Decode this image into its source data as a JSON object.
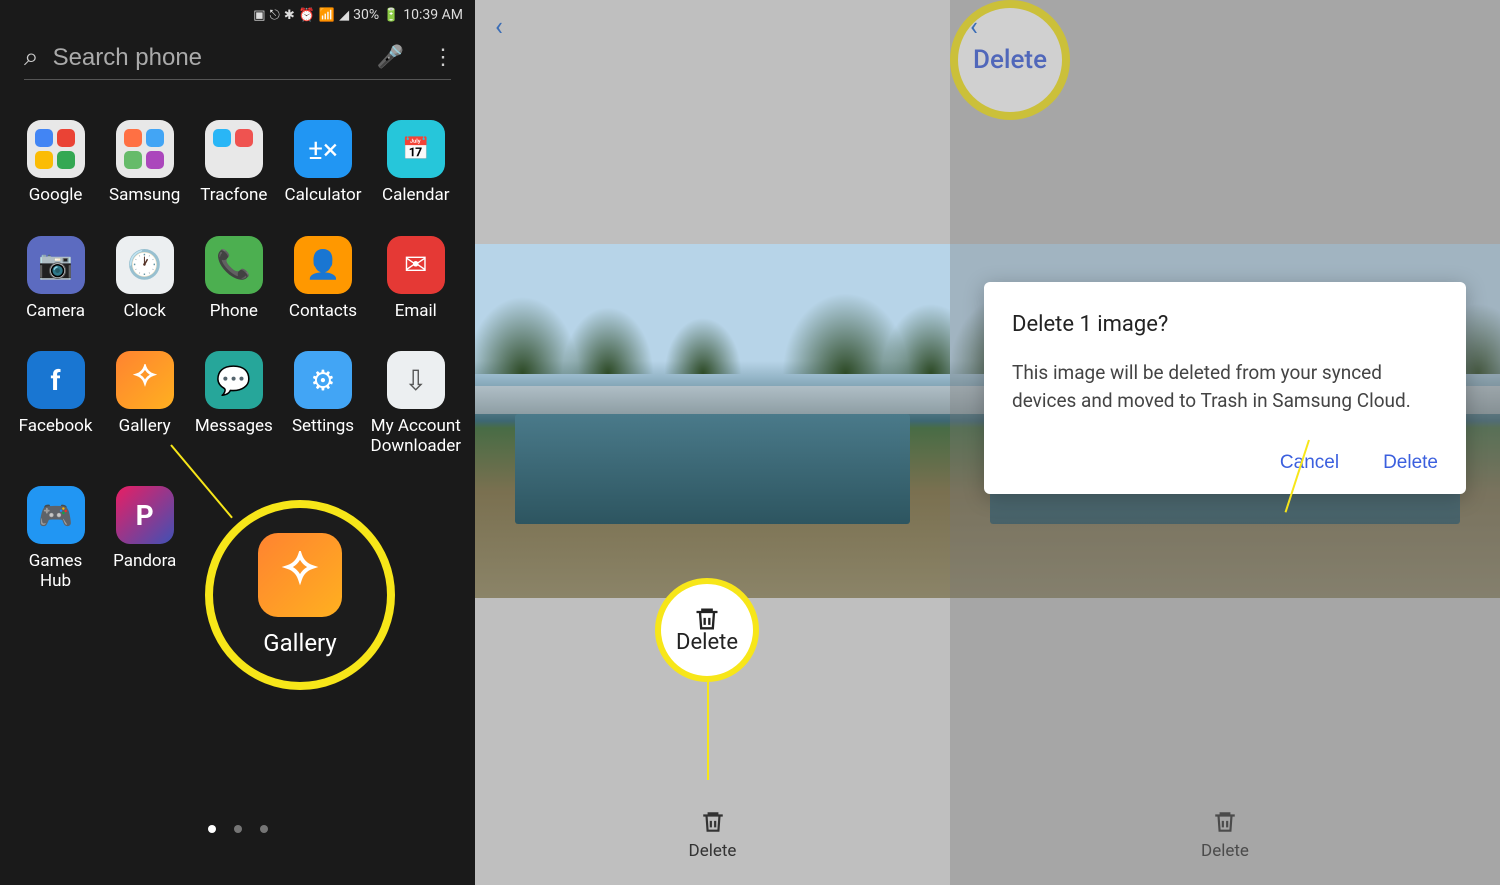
{
  "statusBar": {
    "battery": "30%",
    "time": "10:39 AM"
  },
  "search": {
    "placeholder": "Search phone"
  },
  "apps": {
    "row1": [
      "Google",
      "Samsung",
      "Tracfone",
      "Calculator",
      "Calendar"
    ],
    "row2": [
      "Camera",
      "Clock",
      "Phone",
      "Contacts",
      "Email"
    ],
    "row3": [
      "Facebook",
      "Gallery",
      "Messages",
      "Settings",
      "My Account Downloader"
    ],
    "row4": [
      "Games Hub",
      "Pandora"
    ]
  },
  "highlight1": {
    "label": "Gallery"
  },
  "panel2": {
    "deleteButton": "Delete",
    "highlightLabel": "Delete"
  },
  "panel3": {
    "deleteButton": "Delete",
    "dialog": {
      "title": "Delete 1 image?",
      "body": "This image will be deleted from your synced devices and moved to Trash in Samsung Cloud.",
      "cancel": "Cancel",
      "confirm": "Delete"
    },
    "highlightLabel": "Delete"
  }
}
